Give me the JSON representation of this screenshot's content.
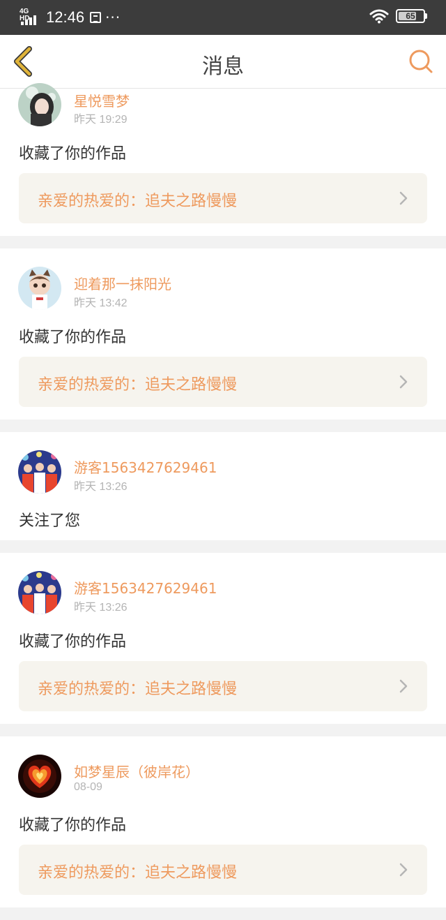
{
  "status_bar": {
    "network": "4G HD",
    "time": "12:46",
    "overflow": "···",
    "battery": "65",
    "icons": [
      "signal-icon",
      "notification-icon",
      "wifi-icon",
      "battery-icon"
    ]
  },
  "header": {
    "title": "消息",
    "back_icon": "chevron-left-icon",
    "search_icon": "search-icon"
  },
  "colors": {
    "accent": "#ee9a5e",
    "back_icon": "#e0b43a",
    "status_bar_bg": "#3c3c3c",
    "link_bg": "#f6f4ee",
    "timestamp": "#b4b4b4"
  },
  "messages": [
    {
      "username": "星悦雪梦",
      "time": "昨天 19:29",
      "action": "收藏了你的作品",
      "work": "亲爱的热爱的：追夫之路慢慢",
      "avatar": "avatar-girl"
    },
    {
      "username": "迎着那一抹阳光",
      "time": "昨天 13:42",
      "action": "收藏了你的作品",
      "work": "亲爱的热爱的：追夫之路慢慢",
      "avatar": "avatar-cartoon-boy"
    },
    {
      "username": "游客1563427629461",
      "time": "昨天 13:26",
      "action": "关注了您",
      "avatar": "avatar-group"
    },
    {
      "username": "游客1563427629461",
      "time": "昨天 13:26",
      "action": "收藏了你的作品",
      "work": "亲爱的热爱的：追夫之路慢慢",
      "avatar": "avatar-group"
    },
    {
      "username": "如梦星辰（彼岸花）",
      "time": "08-09",
      "action": "收藏了你的作品",
      "work": "亲爱的热爱的：追夫之路慢慢",
      "avatar": "avatar-heart"
    }
  ]
}
